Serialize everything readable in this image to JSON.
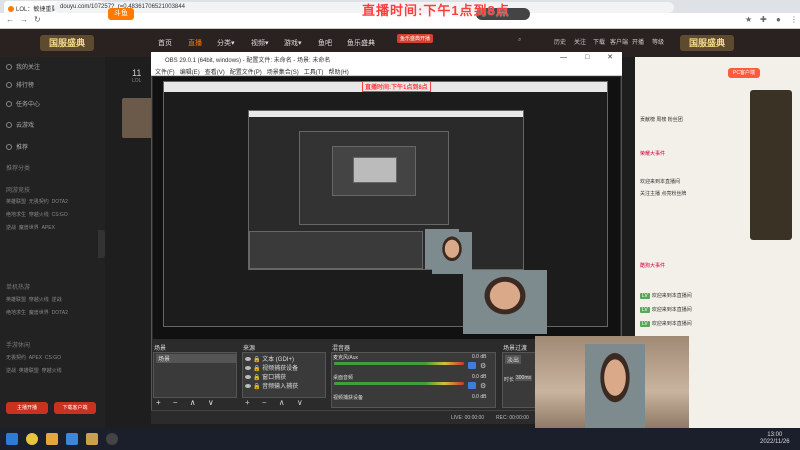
{
  "browser": {
    "tab_title": "LOL：敏捷重翼_斗鱼弹幕直播",
    "tab_close": "×",
    "new_tab": "+",
    "url": "douyu.com/107257?_r=0.48361706521003844"
  },
  "overlay": {
    "banner_text": "直播时间:下午1点到8点"
  },
  "site_header": {
    "logo_left": "国服盛典",
    "logo_right": "国服盛典",
    "brand": "斗鱼",
    "nav": [
      "首页",
      "直播",
      "分类▾",
      "视频▾",
      "游戏▾",
      "鱼吧",
      "鱼乐盛典"
    ],
    "promo_badge": "鱼乐盛典开播",
    "header_icons": [
      "历史",
      "关注",
      "下载",
      "客户端",
      "开播",
      "等级"
    ]
  },
  "sidebar": {
    "items": [
      "我的关注",
      "排行榜",
      "任务中心",
      "云游戏",
      "推荐"
    ],
    "section_headings": [
      "推荐分类",
      "网游竞技",
      "单机热游",
      "手游休闲"
    ],
    "games_row1": [
      "英雄联盟",
      "无畏契约",
      "DOTA2"
    ],
    "games_row2": [
      "绝地求生",
      "穿越火线",
      "CS:GO"
    ],
    "games_row3": [
      "逆战",
      "魔兽世界",
      "APEX"
    ],
    "btn_left": "主播开播",
    "btn_right": "下载客户端"
  },
  "room": {
    "count_big": "11",
    "count_small": "LOL"
  },
  "obs": {
    "title": "OBS 29.0.1 (64bit, windows) - 配置文件: 未命名 - 场景: 未命名",
    "window_controls": "— □ ✕",
    "menu": [
      "文件(F)",
      "编辑(E)",
      "查看(V)",
      "配置文件(P)",
      "场景集合(S)",
      "工具(T)",
      "帮助(H)"
    ],
    "docks": {
      "scenes_title": "场景",
      "scene_item": "场景",
      "sources_title": "来源",
      "sources": [
        "文本 (GDI+)",
        "视频捕获设备",
        "窗口捕获",
        "音频输入捕获"
      ],
      "mixer_title": "混音器",
      "mixer_tracks": [
        {
          "name": "麦克风/Aux",
          "db": "0.0 dB"
        },
        {
          "name": "桌面音频",
          "db": "0.0 dB"
        },
        {
          "name": "视频捕获设备",
          "db": "0.0 dB"
        }
      ],
      "transitions_title": "场景过渡",
      "transition_type": "淡出",
      "duration_label": "时长",
      "duration_value": "300ms",
      "tools": "+ − ∧ ∨"
    },
    "status": {
      "live": "LIVE: 00:00:00",
      "rec": "REC: 00:00:00"
    }
  },
  "right_panel": {
    "button": "PC客户端",
    "rows": [
      "贡献榜 周榜 粉丝团",
      "荣耀大事件",
      "欢迎来到本直播间",
      "关注主播 点亮粉丝牌",
      "酷狗大事件",
      "欢迎来到本直播间",
      "欢迎来到本直播间"
    ],
    "chat_tags": [
      "LV",
      "LV",
      "LV"
    ]
  },
  "taskbar": {
    "time": "13:00",
    "date": "2022/11/26"
  }
}
